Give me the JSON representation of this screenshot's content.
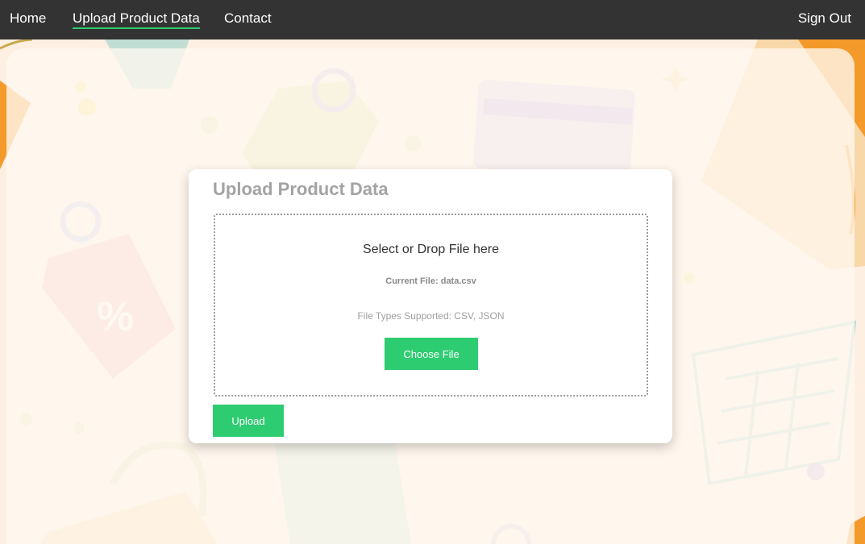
{
  "nav": {
    "home": "Home",
    "upload": "Upload Product Data",
    "contact": "Contact",
    "sign_out": "Sign Out"
  },
  "card": {
    "title": "Upload Product Data",
    "drop_title": "Select or Drop File here",
    "current_file_label": "Current File:",
    "current_file_value": "data.csv",
    "file_types": "File Types Supported: CSV, JSON",
    "choose_button": "Choose File",
    "upload_button": "Upload"
  },
  "colors": {
    "navbar": "#333333",
    "accent": "#2ecc71",
    "background": "#fdf0e2"
  }
}
